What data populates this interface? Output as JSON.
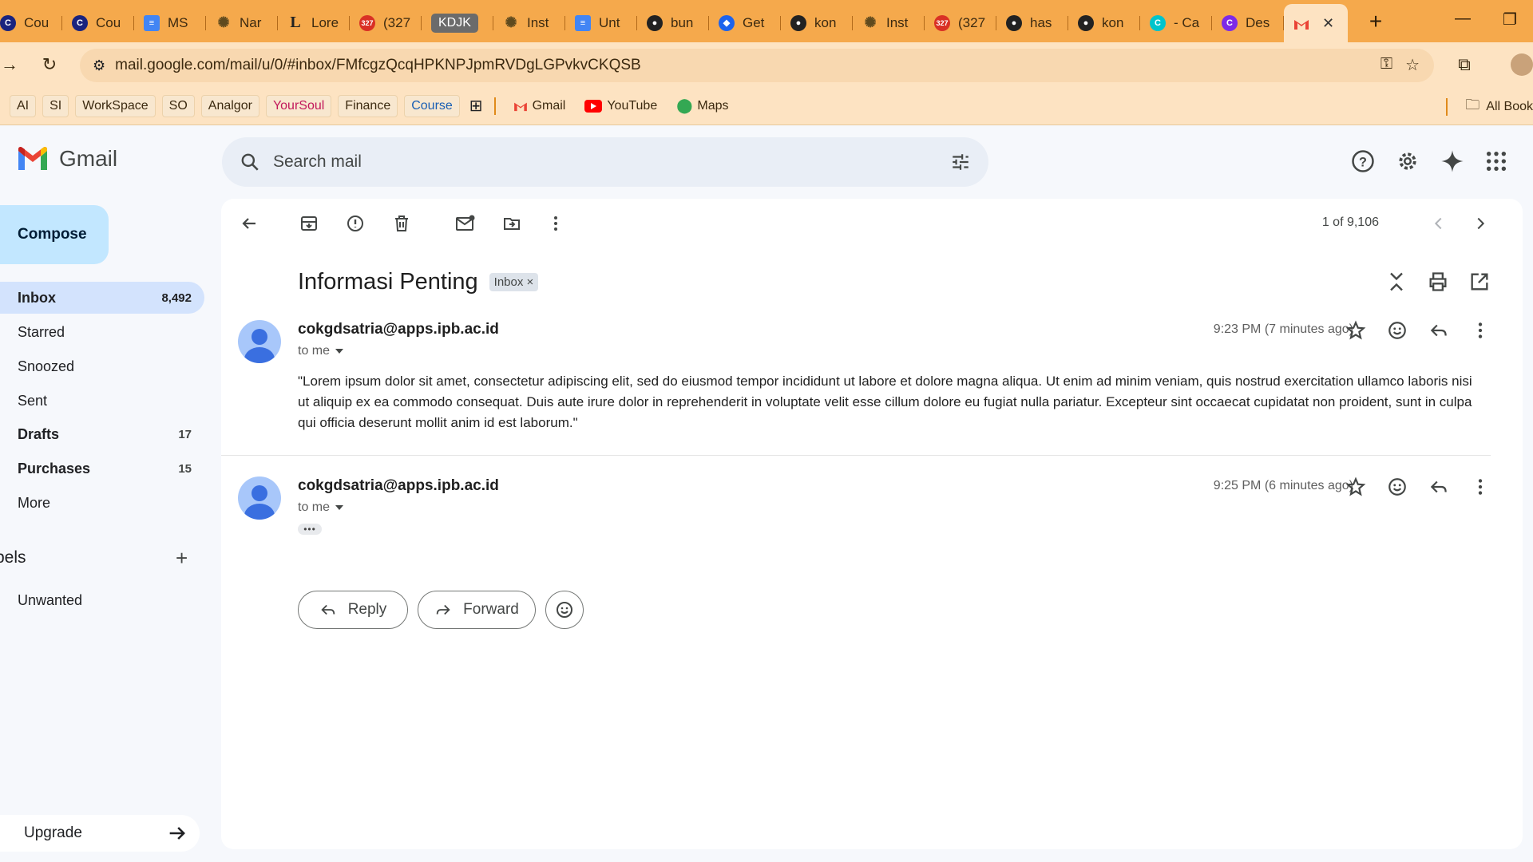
{
  "browser": {
    "tabs": [
      {
        "label": "Cou",
        "icon": "coursera-icon"
      },
      {
        "label": "Cou",
        "icon": "coursera-icon"
      },
      {
        "label": "MS",
        "icon": "docs-icon"
      },
      {
        "label": "Nar",
        "icon": "openai-icon"
      },
      {
        "label": "Lore",
        "icon": "l-icon"
      },
      {
        "label": "(327",
        "icon": "notification-icon"
      },
      {
        "label": "KDJK",
        "icon": "badge"
      },
      {
        "label": "Inst",
        "icon": "openai-icon"
      },
      {
        "label": "Unt",
        "icon": "docs-icon"
      },
      {
        "label": "bun",
        "icon": "github-icon"
      },
      {
        "label": "Get",
        "icon": "docker-icon"
      },
      {
        "label": "kon",
        "icon": "github-icon"
      },
      {
        "label": "Inst",
        "icon": "openai-icon"
      },
      {
        "label": "(327",
        "icon": "notification-icon"
      },
      {
        "label": "has",
        "icon": "github-icon"
      },
      {
        "label": "kon",
        "icon": "github-icon"
      },
      {
        "label": "- Ca",
        "icon": "canva-icon"
      },
      {
        "label": "Des",
        "icon": "canva-icon"
      }
    ],
    "active_tab_close": "✕",
    "url": "mail.google.com/mail/u/0/#inbox/FMfcgzQcqHPKNPJpmRVDgLGPvkvCKQSB",
    "bookmarks": [
      "AI",
      "SI",
      "WorkSpace",
      "SO",
      "Analgor",
      "YourSoul",
      "Finance",
      "Course"
    ],
    "bookmark_links": [
      "Gmail",
      "YouTube",
      "Maps"
    ],
    "all_bookmarks": "All Book"
  },
  "gmail": {
    "logo_text": "Gmail",
    "search_placeholder": "Search mail",
    "compose": "Compose",
    "nav": [
      {
        "label": "Inbox",
        "count": "8,492"
      },
      {
        "label": "Starred",
        "count": ""
      },
      {
        "label": "Snoozed",
        "count": ""
      },
      {
        "label": "Sent",
        "count": ""
      },
      {
        "label": "Drafts",
        "count": "17"
      },
      {
        "label": "Purchases",
        "count": "15"
      },
      {
        "label": "More",
        "count": ""
      }
    ],
    "labels_heading": "bels",
    "labels": [
      "Unwanted"
    ],
    "upgrade": "Upgrade",
    "pager": "1 of 9,106",
    "subject": "Informasi Penting",
    "subject_tag": "Inbox ×",
    "messages": [
      {
        "sender": "cokgdsatria@apps.ipb.ac.id",
        "to": "to me",
        "time": "9:23 PM (7 minutes ago)",
        "body": "\"Lorem ipsum dolor sit amet, consectetur adipiscing elit, sed do eiusmod tempor incididunt ut labore et dolore magna aliqua. Ut enim ad minim veniam, quis nostrud exercitation ullamco laboris nisi ut aliquip ex ea commodo consequat. Duis aute irure dolor in reprehenderit in voluptate velit esse cillum dolore eu fugiat nulla pariatur. Excepteur sint occaecat cupidatat non proident, sunt in culpa qui officia deserunt mollit anim id est laborum.\""
      },
      {
        "sender": "cokgdsatria@apps.ipb.ac.id",
        "to": "to me",
        "time": "9:25 PM (6 minutes ago)",
        "trimmed": "•••"
      }
    ],
    "reply": "Reply",
    "forward": "Forward"
  },
  "colors": {
    "chrome_tabstrip": "#f5a94c",
    "chrome_toolbar": "#fde3c2",
    "compose_bg": "#c2e7ff",
    "inbox_active": "#d3e3fd"
  }
}
